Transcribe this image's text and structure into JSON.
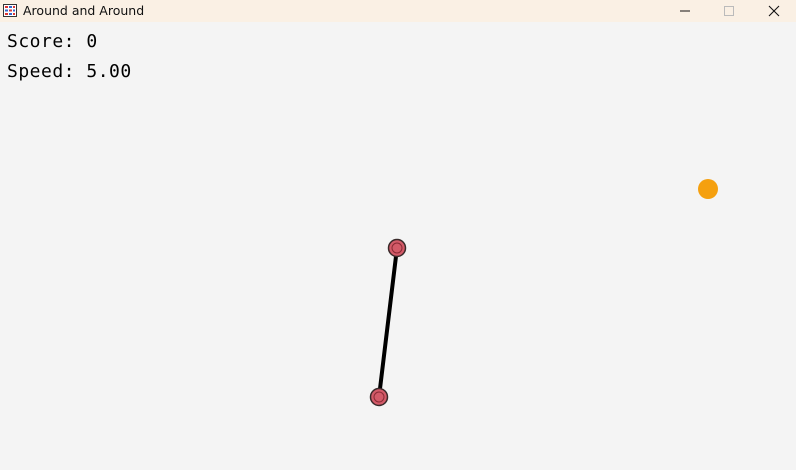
{
  "window": {
    "title": "Around and Around",
    "icon": "app-grid-icon",
    "controls": {
      "minimize_icon": "minimize-icon",
      "maximize_icon": "maximize-icon",
      "close_icon": "close-icon"
    }
  },
  "hud": {
    "score_label": "Score:",
    "score_value": "0",
    "speed_label": "Speed:",
    "speed_value": "5.00"
  },
  "colors": {
    "background": "#f4f4f4",
    "titlebar": "#faf0e4",
    "pivot_fill": "#d35a68",
    "pivot_stroke": "#3a2a2a",
    "rod": "#000000",
    "target": "#f5a00f"
  }
}
